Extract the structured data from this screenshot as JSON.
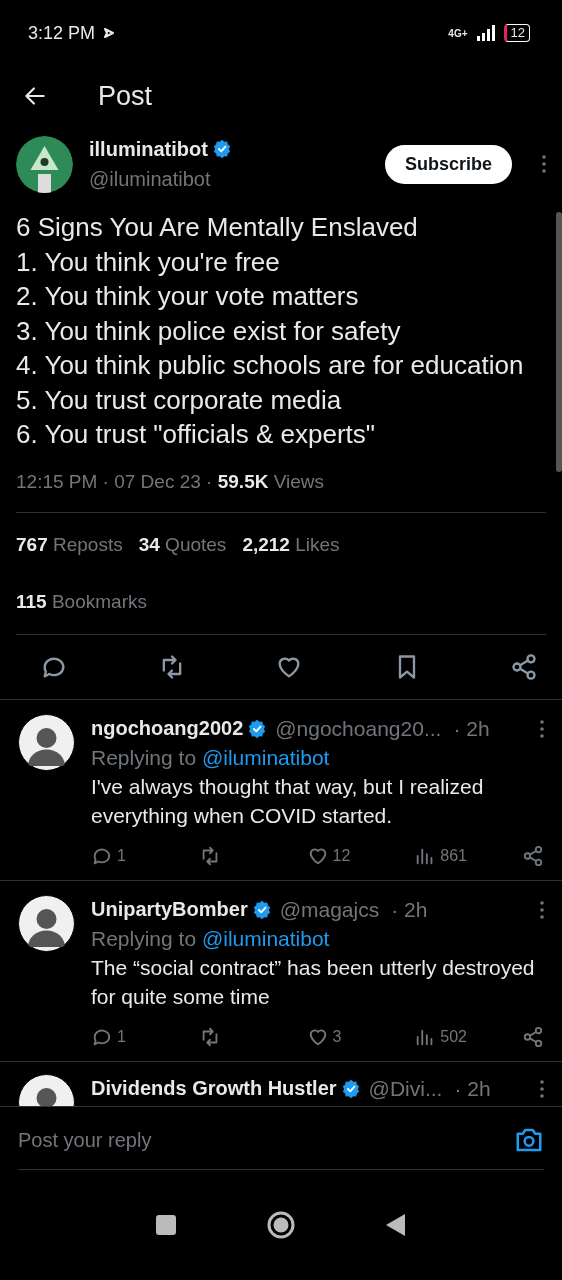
{
  "status_bar": {
    "time": "3:12 PM",
    "network": "4G+",
    "battery": "12"
  },
  "header": {
    "title": "Post"
  },
  "post": {
    "author": {
      "name": "illuminatibot",
      "handle": "@iluminatibot",
      "verified": true
    },
    "subscribe": "Subscribe",
    "text": "6 Signs You Are Mentally Enslaved\n1. You think you're free\n2. You think your vote matters\n3. You think police exist for safety\n4. You think public schools are for education\n5. You trust corporate media\n6. You trust \"officials & experts\"",
    "time": "12:15 PM · 07 Dec 23 · ",
    "views_count": "59.5K",
    "views_label": " Views",
    "stats": [
      {
        "count": "767",
        "label": "Reposts"
      },
      {
        "count": "34",
        "label": "Quotes"
      },
      {
        "count": "2,212",
        "label": "Likes"
      }
    ],
    "bookmarks": {
      "count": "115",
      "label": "Bookmarks"
    }
  },
  "replies": [
    {
      "name": "ngochoang2002",
      "verified": true,
      "handle": "@ngochoang20...",
      "time": "· 2h",
      "replying_label": "Replying to",
      "replying_to": "@iluminatibot",
      "text": "I've always thought that way, but I realized everything when COVID started.",
      "replies": "1",
      "likes": "12",
      "views": "861"
    },
    {
      "name": "UnipartyBomber",
      "verified": true,
      "handle": "@magajcs",
      "time": "· 2h",
      "replying_label": "Replying to",
      "replying_to": "@iluminatibot",
      "text": "The “social contract” has been utterly destroyed for quite some time",
      "replies": "1",
      "likes": "3",
      "views": "502"
    },
    {
      "name": "Dividends Growth Hustler",
      "verified": true,
      "handle": "@Divi...",
      "time": "· 2h"
    }
  ],
  "reply_bar": {
    "placeholder": "Post your reply"
  }
}
